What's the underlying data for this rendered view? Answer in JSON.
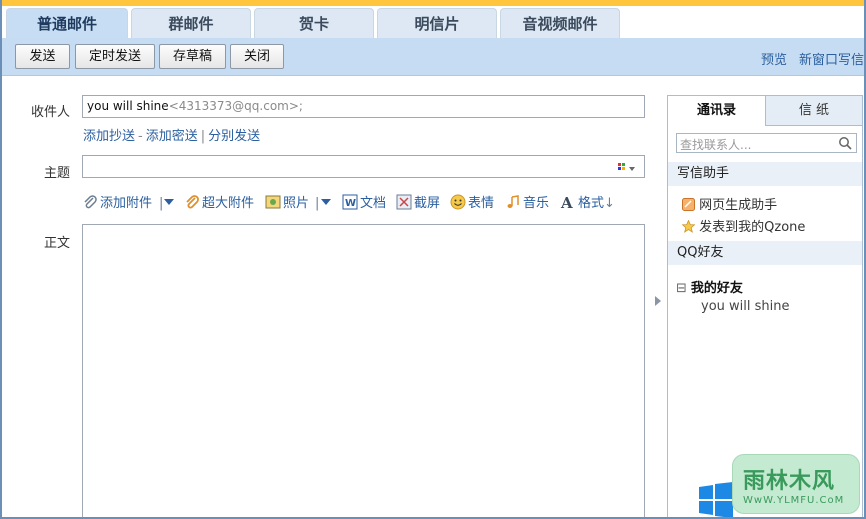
{
  "tabs": [
    {
      "label": "普通邮件",
      "active": true
    },
    {
      "label": "群邮件",
      "active": false
    },
    {
      "label": "贺卡",
      "active": false
    },
    {
      "label": "明信片",
      "active": false
    },
    {
      "label": "音视频邮件",
      "active": false
    }
  ],
  "toolbar": {
    "send": "发送",
    "scheduled_send": "定时发送",
    "save_draft": "存草稿",
    "close": "关闭",
    "preview": "预览",
    "new_window": "新窗口写信"
  },
  "compose": {
    "to_label": "收件人",
    "recipient_name": "you will shine",
    "recipient_addr": "<4313373@qq.com>;",
    "add_cc": "添加抄送",
    "add_bcc": "添加密送",
    "separate_send": "分别发送",
    "subject_label": "主题",
    "subject_value": "",
    "body_label": "正文",
    "body_value": ""
  },
  "format_bar": {
    "attach": "添加附件",
    "big_attach": "超大附件",
    "photo": "照片",
    "doc": "文档",
    "screenshot": "截屏",
    "emoji": "表情",
    "music": "音乐",
    "format": "格式"
  },
  "side_panel": {
    "tab_contacts": "通讯录",
    "tab_stationery": "信  纸",
    "search_placeholder": "查找联系人...",
    "helper_title": "写信助手",
    "helper_items": [
      "网页生成助手",
      "发表到我的Qzone"
    ],
    "qq_friends_title": "QQ好友",
    "group_name": "我的好友",
    "group_toggle": "⊟",
    "friend": "you will shine"
  },
  "watermark": {
    "brand": "雨林木风",
    "url": "WwW.YLMFU.CoM"
  },
  "colors": {
    "accent_top": "#ffc63d",
    "toolbar_bg": "#c6dcf2",
    "link": "#2b5fa0"
  }
}
